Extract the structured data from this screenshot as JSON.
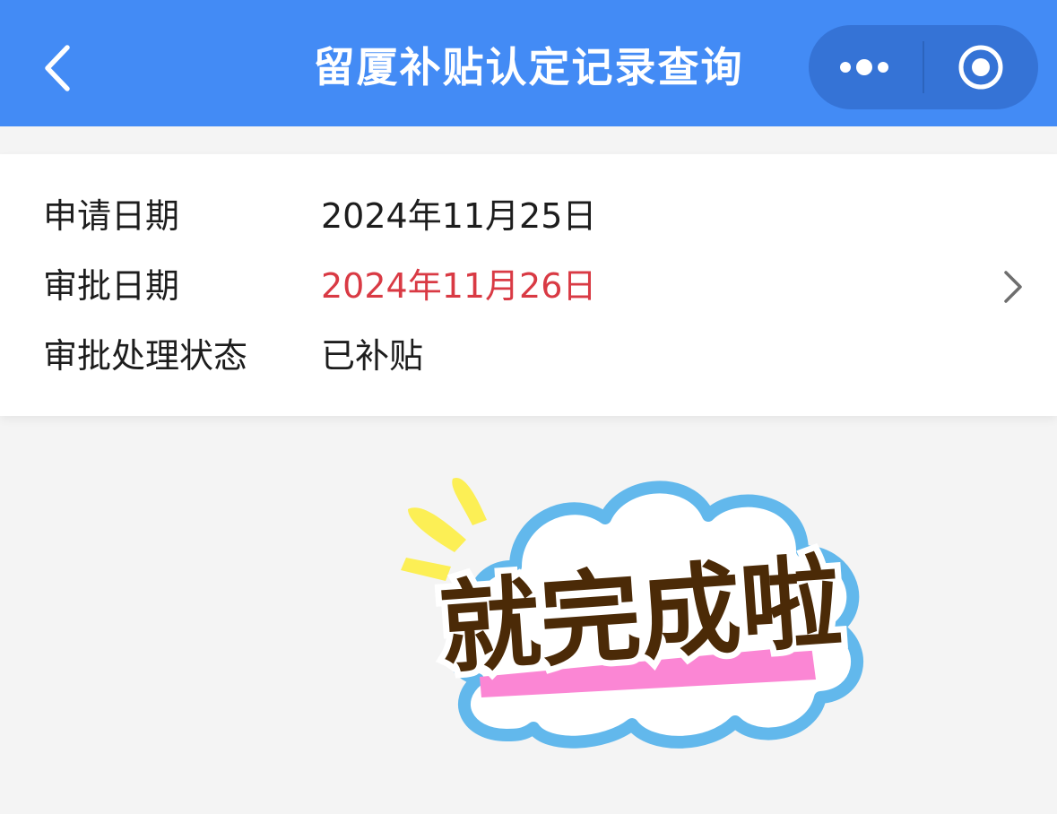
{
  "header": {
    "title": "留厦补贴认定记录查询",
    "background_color": "#438bf5",
    "back_icon": "chevron-left-icon",
    "more_icon": "more-dots-icon",
    "close_icon": "target-circle-icon"
  },
  "record": {
    "rows": [
      {
        "label": "申请日期",
        "value": "2024年11月25日"
      },
      {
        "label": "审批日期",
        "value": "2024年11月26日",
        "value_color": "#d93a44"
      },
      {
        "label": "审批处理状态",
        "value": "已补贴"
      }
    ],
    "detail_icon": "chevron-right-icon"
  },
  "sticker": {
    "text": "就完成啦"
  }
}
